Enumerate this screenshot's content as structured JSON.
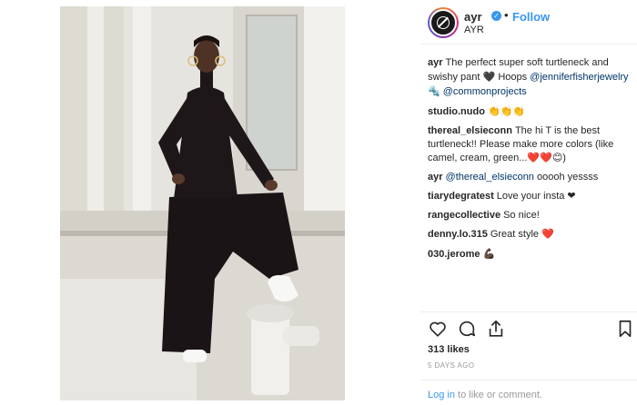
{
  "header": {
    "handle": "ayr",
    "follow_label": "Follow",
    "subtitle": "AYR",
    "dot": "•"
  },
  "caption": {
    "user": "ayr",
    "text_1": "The perfect super soft turtleneck and swishy pant",
    "emoji_1": "🖤",
    "text_2": "Hoops",
    "mention_1": "@jenniferfisherjewelry",
    "emoji_2": "🔩",
    "mention_2": "@commonprojects"
  },
  "comments": [
    {
      "user": "studio.nudo",
      "text": "👏👏👏"
    },
    {
      "user": "thereal_elsieconn",
      "text": "The hi T is the best turtleneck!! Please make more colors (like camel, cream, green...❤️❤️😊)"
    },
    {
      "user": "ayr",
      "mention": "@thereal_elsieconn",
      "text": "ooooh yessss"
    },
    {
      "user": "tiarydegratest",
      "text": "Love your insta ❤"
    },
    {
      "user": "rangecollective",
      "text": "So nice!"
    },
    {
      "user": "denny.lo.315",
      "text": "Great style ❤️"
    },
    {
      "user": "030.jerome",
      "text": "💪🏿"
    }
  ],
  "actions": {
    "like_icon": "heart-icon",
    "comment_icon": "comment-icon",
    "share_icon": "share-icon",
    "save_icon": "bookmark-icon"
  },
  "likes_text": "313 likes",
  "time_ago": "5 DAYS AGO",
  "login": {
    "link": "Log in",
    "text": "to like or comment."
  },
  "colors": {
    "link_blue": "#3897f0",
    "mention_blue": "#003569",
    "muted": "#999999"
  }
}
